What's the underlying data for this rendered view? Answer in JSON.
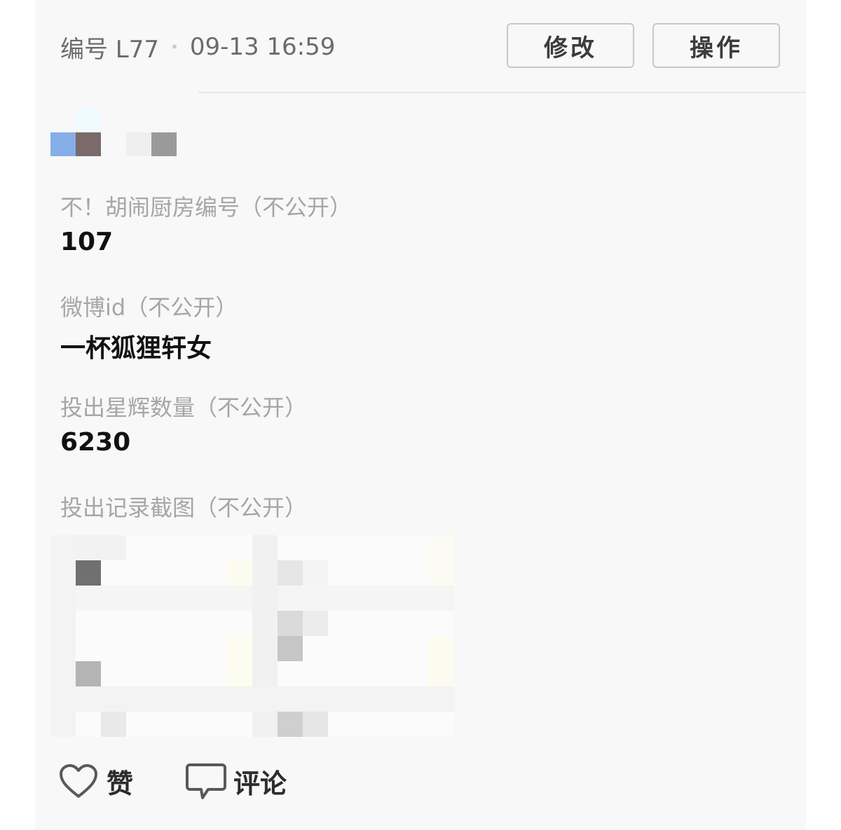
{
  "post": {
    "id_label": "编号 L77",
    "separator": "•",
    "timestamp": "09-13 16:59",
    "edit_label": "修改",
    "operate_label": "操作"
  },
  "fields": [
    {
      "label": "不！胡闹厨房编号（不公开）",
      "value": "107"
    },
    {
      "label": "微博id（不公开）",
      "value": "一杯狐狸轩女"
    },
    {
      "label": "投出星辉数量（不公开）",
      "value": "6230"
    },
    {
      "label": "投出记录截图（不公开）",
      "value": ""
    }
  ],
  "footer": {
    "like_label": "赞",
    "comment_label": "评论"
  },
  "icons": {
    "like": "heart-icon",
    "comment": "comment-bubble-icon"
  },
  "colors": {
    "card_bg": "#f7f8f7",
    "label_gray": "#a6a6a6",
    "value_black": "#111111"
  }
}
